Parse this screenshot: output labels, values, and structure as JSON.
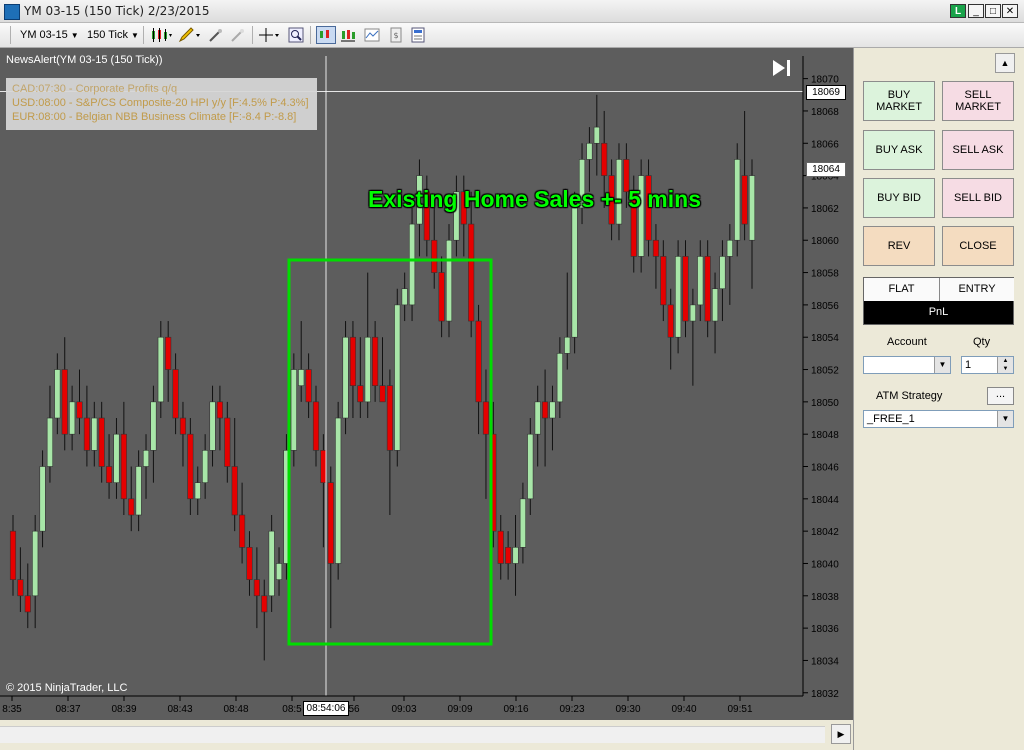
{
  "window": {
    "title": "YM 03-15 (150 Tick)  2/23/2015",
    "buttons": [
      "_",
      "□",
      "✕"
    ]
  },
  "toolbar": {
    "instrument": "YM 03-15",
    "interval": "150 Tick"
  },
  "chart": {
    "indicator_label": "NewsAlert(YM 03-15 (150 Tick))",
    "news": [
      {
        "text": "CAD:07:30 - Corporate Profits q/q",
        "color": "#c9aa6b"
      },
      {
        "text": "USD:08:00 - S&P/CS Composite-20 HPI y/y [F:4.5% P:4.3%]",
        "color": "#c9a04a"
      },
      {
        "text": "EUR:08:00 - Belgian NBB Business Climate [F:-8.4 P:-8.8]",
        "color": "#c9a04a"
      }
    ],
    "annotation": "Existing Home Sales +- 5 mins",
    "copyright": "© 2015 NinjaTrader, LLC",
    "crosshair_time": "08:54:06",
    "crosshair_price": "18069",
    "last_price": "18064",
    "colors": {
      "background": "#5d5d5d",
      "up": "#a8e6a8",
      "down": "#e60000",
      "wick": "#111111",
      "annotation": "#00ff00",
      "box": "#00dd00",
      "axis_text": "#000000"
    }
  },
  "chart_data": {
    "type": "candlestick",
    "y_ticks": [
      18070,
      18068,
      18066,
      18064,
      18062,
      18060,
      18058,
      18056,
      18054,
      18052,
      18050,
      18048,
      18046,
      18044,
      18042,
      18040,
      18038,
      18036,
      18034,
      18032
    ],
    "x_ticks": [
      "8:35",
      "08:37",
      "08:39",
      "08:43",
      "08:48",
      "08:5",
      "56",
      "09:03",
      "09:09",
      "09:16",
      "09:23",
      "09:30",
      "09:40",
      "09:51"
    ],
    "ylim": [
      18031.8,
      18071.4
    ],
    "candles": [
      {
        "o": 18042,
        "h": 18043,
        "l": 18038,
        "c": 18039
      },
      {
        "o": 18039,
        "h": 18041,
        "l": 18037,
        "c": 18038
      },
      {
        "o": 18038,
        "h": 18040,
        "l": 18036,
        "c": 18037
      },
      {
        "o": 18038,
        "h": 18043,
        "l": 18036,
        "c": 18042
      },
      {
        "o": 18042,
        "h": 18047,
        "l": 18041,
        "c": 18046
      },
      {
        "o": 18046,
        "h": 18051,
        "l": 18045,
        "c": 18049
      },
      {
        "o": 18049,
        "h": 18053,
        "l": 18048,
        "c": 18052
      },
      {
        "o": 18052,
        "h": 18054,
        "l": 18047,
        "c": 18048
      },
      {
        "o": 18048,
        "h": 18051,
        "l": 18047,
        "c": 18050
      },
      {
        "o": 18050,
        "h": 18052,
        "l": 18048,
        "c": 18049
      },
      {
        "o": 18049,
        "h": 18051,
        "l": 18046,
        "c": 18047
      },
      {
        "o": 18047,
        "h": 18050,
        "l": 18046,
        "c": 18049
      },
      {
        "o": 18049,
        "h": 18050,
        "l": 18045,
        "c": 18046
      },
      {
        "o": 18046,
        "h": 18048,
        "l": 18044,
        "c": 18045
      },
      {
        "o": 18045,
        "h": 18049,
        "l": 18044,
        "c": 18048
      },
      {
        "o": 18048,
        "h": 18050,
        "l": 18043,
        "c": 18044
      },
      {
        "o": 18044,
        "h": 18046,
        "l": 18042,
        "c": 18043
      },
      {
        "o": 18043,
        "h": 18047,
        "l": 18042,
        "c": 18046
      },
      {
        "o": 18046,
        "h": 18048,
        "l": 18044,
        "c": 18047
      },
      {
        "o": 18047,
        "h": 18051,
        "l": 18045,
        "c": 18050
      },
      {
        "o": 18050,
        "h": 18055,
        "l": 18049,
        "c": 18054
      },
      {
        "o": 18054,
        "h": 18055,
        "l": 18050,
        "c": 18052
      },
      {
        "o": 18052,
        "h": 18053,
        "l": 18048,
        "c": 18049
      },
      {
        "o": 18049,
        "h": 18050,
        "l": 18046,
        "c": 18048
      },
      {
        "o": 18048,
        "h": 18049,
        "l": 18043,
        "c": 18044
      },
      {
        "o": 18044,
        "h": 18046,
        "l": 18043,
        "c": 18045
      },
      {
        "o": 18045,
        "h": 18048,
        "l": 18044,
        "c": 18047
      },
      {
        "o": 18047,
        "h": 18051,
        "l": 18046,
        "c": 18050
      },
      {
        "o": 18050,
        "h": 18051,
        "l": 18047,
        "c": 18049
      },
      {
        "o": 18049,
        "h": 18050,
        "l": 18045,
        "c": 18046
      },
      {
        "o": 18046,
        "h": 18049,
        "l": 18042,
        "c": 18043
      },
      {
        "o": 18043,
        "h": 18045,
        "l": 18040,
        "c": 18041
      },
      {
        "o": 18041,
        "h": 18042,
        "l": 18038,
        "c": 18039
      },
      {
        "o": 18039,
        "h": 18041,
        "l": 18036,
        "c": 18038
      },
      {
        "o": 18038,
        "h": 18039,
        "l": 18034,
        "c": 18037
      },
      {
        "o": 18038,
        "h": 18043,
        "l": 18037,
        "c": 18042
      },
      {
        "o": 18039,
        "h": 18041,
        "l": 18038,
        "c": 18040
      },
      {
        "o": 18040,
        "h": 18048,
        "l": 18039,
        "c": 18047
      },
      {
        "o": 18047,
        "h": 18053,
        "l": 18046,
        "c": 18052
      },
      {
        "o": 18051,
        "h": 18055,
        "l": 18050,
        "c": 18052
      },
      {
        "o": 18052,
        "h": 18053,
        "l": 18049,
        "c": 18050
      },
      {
        "o": 18050,
        "h": 18051,
        "l": 18046,
        "c": 18047
      },
      {
        "o": 18047,
        "h": 18048,
        "l": 18041,
        "c": 18045
      },
      {
        "o": 18045,
        "h": 18046,
        "l": 18036,
        "c": 18040
      },
      {
        "o": 18040,
        "h": 18050,
        "l": 18039,
        "c": 18049
      },
      {
        "o": 18049,
        "h": 18055,
        "l": 18048,
        "c": 18054
      },
      {
        "o": 18054,
        "h": 18055,
        "l": 18049,
        "c": 18051
      },
      {
        "o": 18051,
        "h": 18054,
        "l": 18049,
        "c": 18050
      },
      {
        "o": 18050,
        "h": 18058,
        "l": 18049,
        "c": 18054
      },
      {
        "o": 18054,
        "h": 18055,
        "l": 18050,
        "c": 18051
      },
      {
        "o": 18051,
        "h": 18054,
        "l": 18050,
        "c": 18050
      },
      {
        "o": 18051,
        "h": 18052,
        "l": 18043,
        "c": 18047
      },
      {
        "o": 18047,
        "h": 18057,
        "l": 18046,
        "c": 18056
      },
      {
        "o": 18056,
        "h": 18058,
        "l": 18055,
        "c": 18057
      },
      {
        "o": 18056,
        "h": 18062,
        "l": 18055,
        "c": 18061
      },
      {
        "o": 18061,
        "h": 18065,
        "l": 18059,
        "c": 18064
      },
      {
        "o": 18063,
        "h": 18064,
        "l": 18059,
        "c": 18060
      },
      {
        "o": 18060,
        "h": 18062,
        "l": 18057,
        "c": 18058
      },
      {
        "o": 18058,
        "h": 18059,
        "l": 18054,
        "c": 18055
      },
      {
        "o": 18055,
        "h": 18061,
        "l": 18054,
        "c": 18060
      },
      {
        "o": 18060,
        "h": 18064,
        "l": 18059,
        "c": 18063
      },
      {
        "o": 18063,
        "h": 18064,
        "l": 18059,
        "c": 18061
      },
      {
        "o": 18061,
        "h": 18063,
        "l": 18054,
        "c": 18055
      },
      {
        "o": 18055,
        "h": 18056,
        "l": 18048,
        "c": 18050
      },
      {
        "o": 18050,
        "h": 18052,
        "l": 18044,
        "c": 18048
      },
      {
        "o": 18048,
        "h": 18050,
        "l": 18041,
        "c": 18042
      },
      {
        "o": 18042,
        "h": 18043,
        "l": 18039,
        "c": 18040
      },
      {
        "o": 18041,
        "h": 18042,
        "l": 18039,
        "c": 18040
      },
      {
        "o": 18040,
        "h": 18043,
        "l": 18038,
        "c": 18041
      },
      {
        "o": 18041,
        "h": 18045,
        "l": 18040,
        "c": 18044
      },
      {
        "o": 18044,
        "h": 18049,
        "l": 18043,
        "c": 18048
      },
      {
        "o": 18048,
        "h": 18051,
        "l": 18046,
        "c": 18050
      },
      {
        "o": 18050,
        "h": 18052,
        "l": 18046,
        "c": 18049
      },
      {
        "o": 18049,
        "h": 18051,
        "l": 18047,
        "c": 18050
      },
      {
        "o": 18050,
        "h": 18054,
        "l": 18049,
        "c": 18053
      },
      {
        "o": 18053,
        "h": 18058,
        "l": 18052,
        "c": 18054
      },
      {
        "o": 18054,
        "h": 18063,
        "l": 18053,
        "c": 18062
      },
      {
        "o": 18062,
        "h": 18066,
        "l": 18061,
        "c": 18065
      },
      {
        "o": 18065,
        "h": 18067,
        "l": 18063,
        "c": 18066
      },
      {
        "o": 18066,
        "h": 18069,
        "l": 18064,
        "c": 18067
      },
      {
        "o": 18066,
        "h": 18068,
        "l": 18062,
        "c": 18064
      },
      {
        "o": 18064,
        "h": 18065,
        "l": 18060,
        "c": 18061
      },
      {
        "o": 18061,
        "h": 18066,
        "l": 18060,
        "c": 18065
      },
      {
        "o": 18065,
        "h": 18066,
        "l": 18062,
        "c": 18063
      },
      {
        "o": 18063,
        "h": 18064,
        "l": 18058,
        "c": 18059
      },
      {
        "o": 18059,
        "h": 18065,
        "l": 18058,
        "c": 18064
      },
      {
        "o": 18064,
        "h": 18065,
        "l": 18059,
        "c": 18060
      },
      {
        "o": 18060,
        "h": 18061,
        "l": 18057,
        "c": 18059
      },
      {
        "o": 18059,
        "h": 18060,
        "l": 18055,
        "c": 18056
      },
      {
        "o": 18056,
        "h": 18057,
        "l": 18052,
        "c": 18054
      },
      {
        "o": 18054,
        "h": 18060,
        "l": 18053,
        "c": 18059
      },
      {
        "o": 18059,
        "h": 18060,
        "l": 18054,
        "c": 18055
      },
      {
        "o": 18055,
        "h": 18057,
        "l": 18051,
        "c": 18056
      },
      {
        "o": 18056,
        "h": 18060,
        "l": 18055,
        "c": 18059
      },
      {
        "o": 18059,
        "h": 18060,
        "l": 18054,
        "c": 18055
      },
      {
        "o": 18055,
        "h": 18058,
        "l": 18053,
        "c": 18057
      },
      {
        "o": 18057,
        "h": 18060,
        "l": 18055,
        "c": 18059
      },
      {
        "o": 18059,
        "h": 18061,
        "l": 18056,
        "c": 18060
      },
      {
        "o": 18060,
        "h": 18066,
        "l": 18059,
        "c": 18065
      },
      {
        "o": 18064,
        "h": 18068,
        "l": 18060,
        "c": 18061
      },
      {
        "o": 18060,
        "h": 18065,
        "l": 18057,
        "c": 18064
      }
    ]
  },
  "panel": {
    "scroll_up": "▲",
    "buttons": {
      "buy_market": "BUY MARKET",
      "sell_market": "SELL MARKET",
      "buy_ask": "BUY ASK",
      "sell_ask": "SELL ASK",
      "buy_bid": "BUY BID",
      "sell_bid": "SELL BID",
      "rev": "REV",
      "close": "CLOSE"
    },
    "flat": "FLAT",
    "entry": "ENTRY",
    "pnl": "PnL",
    "account_label": "Account",
    "account_value": "",
    "qty_label": "Qty",
    "qty_value": "1",
    "atm_label": "ATM Strategy",
    "atm_browse": "...",
    "atm_value": "_FREE_1"
  }
}
